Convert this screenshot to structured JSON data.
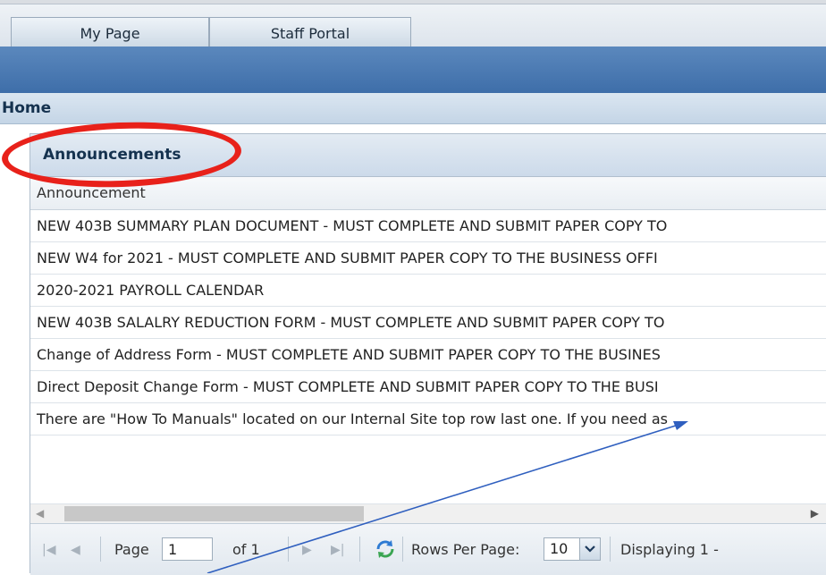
{
  "tabs": [
    {
      "label": "My Page"
    },
    {
      "label": "Staff Portal"
    }
  ],
  "home": {
    "title": "Home"
  },
  "panel": {
    "title": "Announcements",
    "column_header": "Announcement",
    "rows": [
      "NEW 403B SUMMARY PLAN DOCUMENT - MUST COMPLETE AND SUBMIT PAPER COPY TO",
      "NEW W4 for 2021 - MUST COMPLETE AND SUBMIT PAPER COPY TO THE BUSINESS OFFI",
      "2020-2021 PAYROLL CALENDAR",
      "NEW 403B SALALRY REDUCTION FORM - MUST COMPLETE AND SUBMIT PAPER COPY TO",
      "Change of Address Form - MUST COMPLETE AND SUBMIT PAPER COPY TO THE BUSINES",
      "Direct Deposit Change Form - MUST COMPLETE AND SUBMIT PAPER COPY TO THE BUSI",
      "There are \"How To Manuals\" located on our Internal Site top row last one. If you need as"
    ]
  },
  "pager": {
    "page_label": "Page",
    "page_value": "1",
    "of_label": "of 1",
    "rows_label": "Rows Per Page:",
    "rows_value": "10",
    "display_label": "Displaying 1 -"
  },
  "icons": {
    "first": "first-page-icon",
    "prev": "prev-page-icon",
    "next": "next-page-icon",
    "last": "last-page-icon",
    "refresh": "refresh-icon",
    "dropdown": "chevron-down-icon"
  },
  "colors": {
    "accent_blue": "#3e6ea9",
    "highlight_red": "#e8211a",
    "annotation_arrow": "#2f5fbf"
  }
}
